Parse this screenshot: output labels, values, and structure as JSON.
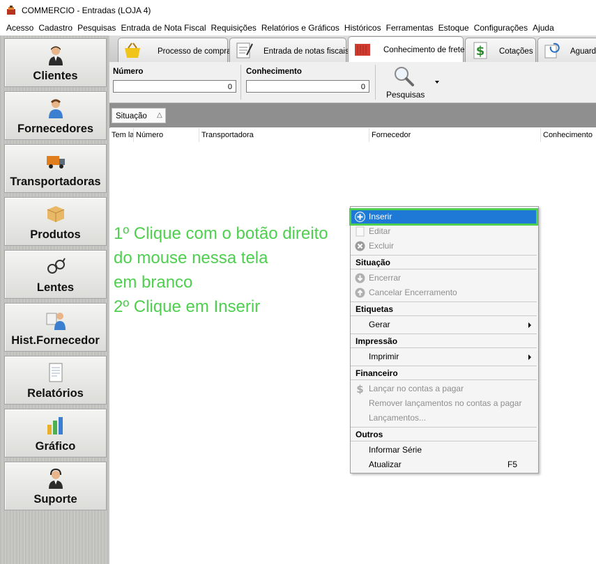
{
  "window": {
    "title": "COMMERCIO - Entradas (LOJA 4)"
  },
  "menu": [
    "Acesso",
    "Cadastro",
    "Pesquisas",
    "Entrada de Nota Fiscal",
    "Requisições",
    "Relatórios e Gráficos",
    "Históricos",
    "Ferramentas",
    "Estoque",
    "Configurações",
    "Ajuda"
  ],
  "sidebar": {
    "items": [
      {
        "label": "Clientes",
        "icon": "person-icon"
      },
      {
        "label": "Fornecedores",
        "icon": "person-icon"
      },
      {
        "label": "Transportadoras",
        "icon": "truck-icon"
      },
      {
        "label": "Produtos",
        "icon": "box-icon"
      },
      {
        "label": "Lentes",
        "icon": "glasses-icon"
      },
      {
        "label": "Hist.Fornecedor",
        "icon": "card-person-icon"
      },
      {
        "label": "Relatórios",
        "icon": "document-icon"
      },
      {
        "label": "Gráfico",
        "icon": "bar-chart-icon"
      },
      {
        "label": "Suporte",
        "icon": "headset-icon"
      }
    ]
  },
  "tabs": [
    {
      "label": "Processo de compra",
      "icon": "basket-icon"
    },
    {
      "label": "Entrada de notas fiscais",
      "icon": "notepad-icon"
    },
    {
      "label": "Conhecimento de frete",
      "icon": "container-icon",
      "active": true
    },
    {
      "label": "Cotações",
      "icon": "dollar-icon"
    },
    {
      "label": "Aguarda",
      "icon": "refresh-doc-icon"
    }
  ],
  "filters": {
    "numero": {
      "label": "Número",
      "value": "0"
    },
    "conhecimento": {
      "label": "Conhecimento",
      "value": "0"
    },
    "pesquisas": {
      "label": "Pesquisas"
    }
  },
  "grouping": {
    "label": "Situação",
    "sort": "△"
  },
  "grid": {
    "columns": [
      "Tem la",
      "Número",
      "Transportadora",
      "Fornecedor",
      "Conhecimento"
    ]
  },
  "instructions": {
    "line1": "1º Clique com o botão direito",
    "line2": "do mouse nessa tela",
    "line3": "em branco",
    "line4": "2º Clique em Inserir"
  },
  "context_menu": {
    "inserir": "Inserir",
    "editar": "Editar",
    "excluir": "Excluir",
    "situacao": "Situação",
    "encerrar": "Encerrar",
    "cancelar_encerramento": "Cancelar Encerramento",
    "etiquetas": "Etiquetas",
    "gerar": "Gerar",
    "impressao": "Impressão",
    "imprimir": "Imprimir",
    "financeiro": "Financeiro",
    "lancar": "Lançar no contas a pagar",
    "remover": "Remover lançamentos no contas a pagar",
    "lancamentos": "Lançamentos...",
    "outros": "Outros",
    "informar_serie": "Informar Série",
    "atualizar": "Atualizar",
    "atualizar_shortcut": "F5"
  },
  "colors": {
    "accent": "#1e78d6",
    "annotation": "#4fcf4f"
  }
}
